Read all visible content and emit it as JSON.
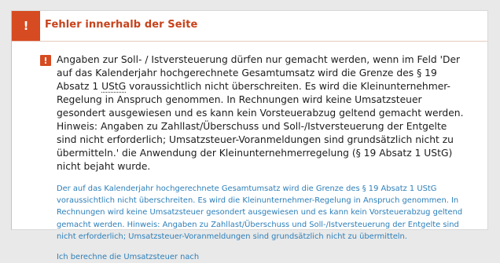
{
  "error": {
    "badge": "!",
    "title": "Fehler innerhalb der Seite",
    "message_icon": "exclamation-icon",
    "message_part1": "Angaben zur Soll- / Istversteuerung dürfen nur gemacht werden, wenn im Feld 'Der auf das Kalenderjahr hochgerechnete Gesamtumsatz wird die Grenze des § 19 Absatz 1 ",
    "message_abbr": "UStG",
    "message_part2": " voraussichtlich nicht überschreiten. Es wird die Kleinunternehmer-Regelung in Anspruch genommen. In Rechnungen wird keine Umsatzsteuer gesondert ausgewiesen und es kann kein Vorsteuerabzug geltend gemacht werden. Hinweis: Angaben zu Zahllast/Überschuss und Soll-/Istversteuerung der Entgelte sind nicht erforderlich; Umsatzsteuer-Voranmeldungen sind grundsätzlich nicht zu übermitteln.' die Anwendung der Kleinunternehmerregelung (§ 19 Absatz 1 UStG) nicht bejaht wurde.",
    "links": [
      "Der auf das Kalenderjahr hochgerechnete Gesamtumsatz wird die Grenze des § 19 Absatz 1 UStG voraussichtlich nicht überschreiten. Es wird die Kleinunternehmer-Regelung in Anspruch genommen. In Rechnungen wird keine Umsatzsteuer gesondert ausgewiesen und es kann kein Vorsteuerabzug geltend gemacht werden. Hinweis: Angaben zu Zahllast/Überschuss und Soll-/Istversteuerung der Entgelte sind nicht erforderlich; Umsatzsteuer-Voranmeldungen sind grundsätzlich nicht zu übermitteln.",
      "Ich berechne die Umsatzsteuer nach"
    ]
  },
  "colors": {
    "accent": "#d64b21",
    "title": "#c7431c",
    "link": "#2d7fb9"
  }
}
